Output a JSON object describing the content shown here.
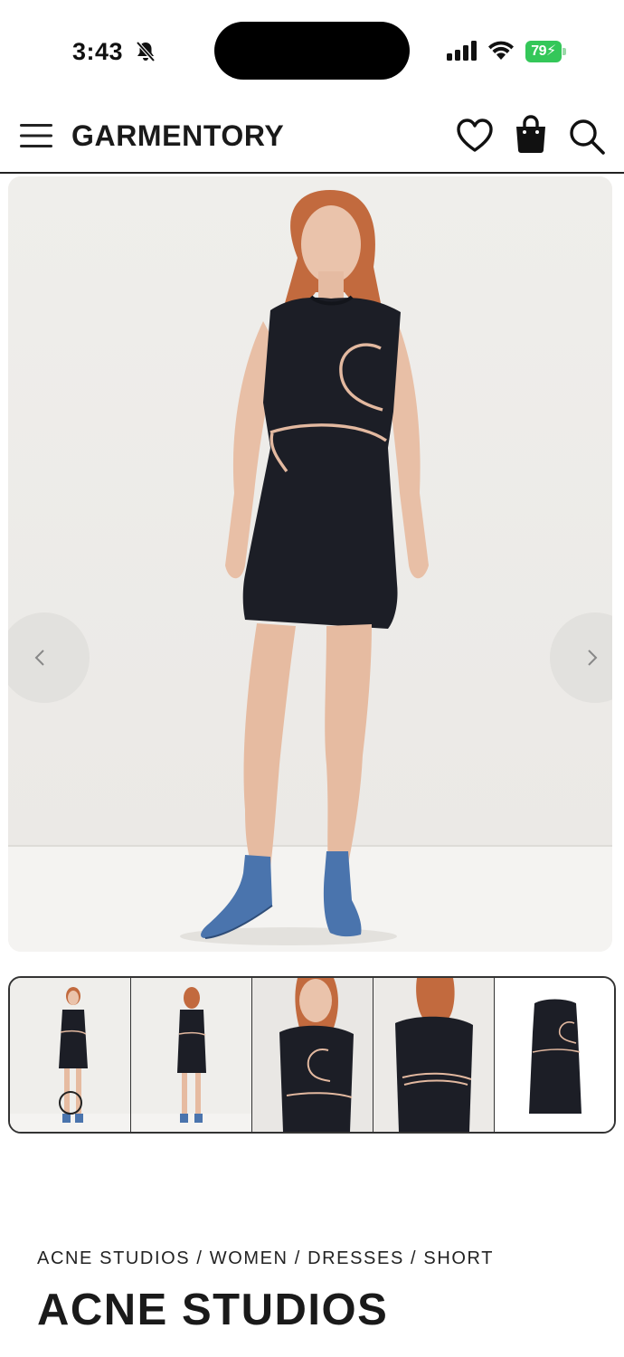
{
  "status_bar": {
    "time": "3:43",
    "battery_level": "79",
    "battery_color": "#34c759",
    "icons": [
      "bell-slash-icon",
      "signal-icon",
      "wifi-icon",
      "battery-icon"
    ]
  },
  "header": {
    "brand": "GARMENTORY",
    "icons": [
      "menu-icon",
      "heart-icon",
      "shopping-bag-icon",
      "search-icon"
    ]
  },
  "gallery": {
    "prev_icon": "chevron-left-icon",
    "next_icon": "chevron-right-icon",
    "thumbnail_count": 5,
    "selected_thumbnail": 1
  },
  "product": {
    "breadcrumb": [
      "ACNE STUDIOS",
      "WOMEN",
      "DRESSES",
      "SHORT"
    ],
    "breadcrumb_separator": " / ",
    "brand": "ACNE STUDIOS"
  },
  "colors": {
    "dress": "#1c1e26",
    "piping": "#e3b9a0",
    "boots": "#4a74ad",
    "hair": "#c26a3e"
  }
}
